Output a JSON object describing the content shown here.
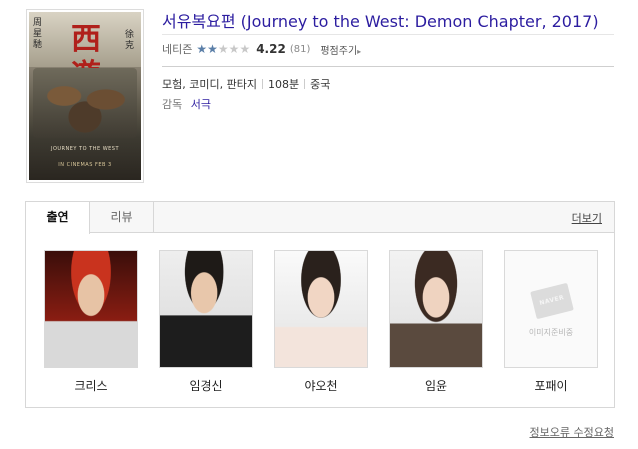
{
  "movie": {
    "title": "서유복요편 (Journey to the West: Demon Chapter, 2017)",
    "rating_label": "네티즌",
    "score": "4.22",
    "rating_count": "(81)",
    "rating_stars": 2,
    "rating_stars_max": 5,
    "review_link": "평점주기",
    "genres": "모험, 코미디, 판타지",
    "runtime": "108분",
    "country": "중국",
    "director_label": "감독",
    "director": "서극"
  },
  "poster": {
    "side_left": "周星馳",
    "side_right": "徐克",
    "logo": "西遊",
    "tagline": "JOURNEY TO THE WEST",
    "release": "IN CINEMAS FEB 3"
  },
  "cast_panel": {
    "tabs": [
      {
        "label": "출연",
        "active": true
      },
      {
        "label": "리뷰",
        "active": false
      }
    ],
    "more_link": "더보기",
    "cast": [
      {
        "name": "크리스"
      },
      {
        "name": "임경신"
      },
      {
        "name": "야오천"
      },
      {
        "name": "임윤"
      },
      {
        "name": "포패이",
        "placeholder_logo": "NAVER",
        "placeholder_text": "이미지준비중"
      }
    ]
  },
  "footer": {
    "report_link": "정보오류 수정요청"
  },
  "colors": {
    "title": "#2c1da0",
    "star_filled": "#5b7fa8",
    "star_empty": "#c8c8c8"
  }
}
